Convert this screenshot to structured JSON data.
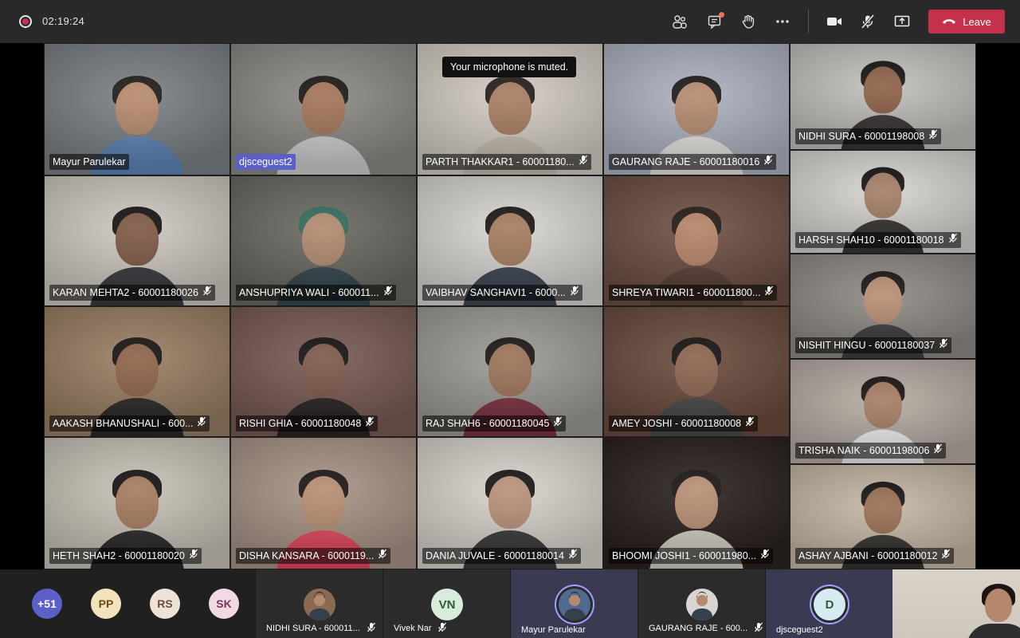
{
  "call": {
    "timer": "02:19:24",
    "leave_label": "Leave",
    "toast": "Your microphone is muted."
  },
  "toolbar_icons": [
    "participants-icon",
    "chat-icon",
    "raise-hand-icon",
    "more-actions-icon",
    "camera-icon",
    "microphone-muted-icon",
    "share-screen-icon"
  ],
  "participants": [
    {
      "name": "Mayur Parulekar",
      "muted": false,
      "guest": false,
      "bg": "#7b8186",
      "skin": "#b78a6c",
      "hair": "#1f1a17",
      "shirt": "#5f86b8"
    },
    {
      "name": "djsceguest2",
      "muted": false,
      "guest": true,
      "bg": "#8b8a86",
      "skin": "#a27458",
      "hair": "#1a1614",
      "shirt": "#cfcfcf"
    },
    {
      "name": "PARTH THAKKAR1 - 60001180...",
      "muted": true,
      "guest": false,
      "bg": "#d4cdc4",
      "skin": "#a77c60",
      "hair": "#241c18",
      "shirt": "#c5bdb1"
    },
    {
      "name": "GAURANG RAJE - 60001180016",
      "muted": true,
      "guest": false,
      "bg": "#aeb3c1",
      "skin": "#b58a6e",
      "hair": "#1b1817",
      "shirt": "#e6e3e0"
    },
    {
      "name": "NIDHI SURA - 60001198008",
      "muted": true,
      "guest": false,
      "bg": "#c3c1bd",
      "skin": "#8d6047",
      "hair": "#151212",
      "shirt": "#3a3535"
    },
    {
      "name": "KARAN MEHTA2 - 60001180026",
      "muted": true,
      "guest": false,
      "bg": "#cfc9c0",
      "skin": "#7d5843",
      "hair": "#141111",
      "shirt": "#3b3a40"
    },
    {
      "name": "ANSHUPRIYA WALI - 600011...",
      "muted": true,
      "guest": false,
      "bg": "#6a6a62",
      "skin": "#b2896f",
      "hair": "#2e6b5c",
      "shirt": "#35464f"
    },
    {
      "name": "VAIBHAV SANGHAVI1 - 6000...",
      "muted": true,
      "guest": false,
      "bg": "#d8d6d2",
      "skin": "#a57b5f",
      "hair": "#1a1412",
      "shirt": "#3d4653"
    },
    {
      "name": "SHREYA TIWARI1 - 600011800...",
      "muted": true,
      "guest": false,
      "bg": "#6e5045",
      "skin": "#b58367",
      "hair": "#221814",
      "shirt": "#5a4138"
    },
    {
      "name": "HARSH SHAH10 - 60001180018",
      "muted": true,
      "guest": false,
      "bg": "#d6d4cf",
      "skin": "#a37e66",
      "hair": "#151211",
      "shirt": "#3a3533"
    },
    {
      "name": "AAKASH BHANUSHALI - 600...",
      "muted": true,
      "guest": false,
      "bg": "#9a7f64",
      "skin": "#8e6249",
      "hair": "#161211",
      "shirt": "#2d2a28"
    },
    {
      "name": "RISHI GHIA - 60001180048",
      "muted": true,
      "guest": false,
      "bg": "#7a5b54",
      "skin": "#7c5848",
      "hair": "#141011",
      "shirt": "#2b2424"
    },
    {
      "name": "RAJ SHAH6 - 60001180045",
      "muted": true,
      "guest": false,
      "bg": "#9d9b94",
      "skin": "#9b7258",
      "hair": "#181412",
      "shirt": "#7d3440"
    },
    {
      "name": "AMEY JOSHI - 60001180008",
      "muted": true,
      "guest": false,
      "bg": "#6b4c3e",
      "skin": "#8a644e",
      "hair": "#141110",
      "shirt": "#4a4a4a"
    },
    {
      "name": "NISHIT HINGU - 60001180037",
      "muted": true,
      "guest": false,
      "bg": "#8f8a84",
      "skin": "#b88d73",
      "hair": "#1a1513",
      "shirt": "#3e3e42"
    },
    {
      "name": "TRISHA NAIK - 60001198006",
      "muted": true,
      "guest": false,
      "bg": "#b6aca3",
      "skin": "#a57c63",
      "hair": "#171312",
      "shirt": "#eeeeee"
    },
    {
      "name": "HETH SHAH2 - 60001180020",
      "muted": true,
      "guest": false,
      "bg": "#c9c3b8",
      "skin": "#a57a5e",
      "hair": "#141111",
      "shirt": "#2c2a2a"
    },
    {
      "name": "DISHA KANSARA - 6000119...",
      "muted": true,
      "guest": false,
      "bg": "#a99486",
      "skin": "#b88d70",
      "hair": "#1b1513",
      "shirt": "#e5485d"
    },
    {
      "name": "DANIA JUVALE - 60001180014",
      "muted": true,
      "guest": false,
      "bg": "#d9d4cc",
      "skin": "#b7917a",
      "hair": "#171312",
      "shirt": "#3b3b3b"
    },
    {
      "name": "BHOOMI JOSHI1 - 600011980...",
      "muted": true,
      "guest": false,
      "bg": "#2b221e",
      "skin": "#b88e74",
      "hair": "#191413",
      "shirt": "#d6cfc5"
    },
    {
      "name": "ASHAY AJBANI - 60001180012",
      "muted": true,
      "guest": false,
      "bg": "#c6b8a6",
      "skin": "#9a6e53",
      "hair": "#151212",
      "shirt": "#35332f"
    }
  ],
  "roster": {
    "overflow_count": "+51",
    "chips": [
      {
        "initials": "PP",
        "bg": "#f3e3bd",
        "fg": "#6b4e14"
      },
      {
        "initials": "RS",
        "bg": "#ece2d7",
        "fg": "#6d4c3d"
      },
      {
        "initials": "SK",
        "bg": "#f1d9e6",
        "fg": "#7a3558"
      }
    ],
    "tiles": [
      {
        "name": "NIDHI SURA - 600011...",
        "initials": "",
        "muted": true,
        "speaking": false,
        "photo": true,
        "bg": "#2b2b2b",
        "avbg": "#8a6b52"
      },
      {
        "name": "Vivek Nar",
        "initials": "VN",
        "muted": true,
        "speaking": false,
        "photo": false,
        "bg": "#2b2b2b",
        "avbg": "#d8ecdc"
      },
      {
        "name": "Mayur Parulekar",
        "initials": "",
        "muted": false,
        "speaking": true,
        "photo": true,
        "bg": "#3a3a52",
        "avbg": "#4f6b8f"
      },
      {
        "name": "GAURANG RAJE - 600...",
        "initials": "",
        "muted": true,
        "speaking": false,
        "photo": true,
        "bg": "#2b2b2b",
        "avbg": "#d9d6d2"
      },
      {
        "name": "djsceguest2",
        "initials": "D",
        "muted": false,
        "speaking": true,
        "photo": false,
        "bg": "#3a3a52",
        "avbg": "#d6ebf2"
      }
    ]
  }
}
